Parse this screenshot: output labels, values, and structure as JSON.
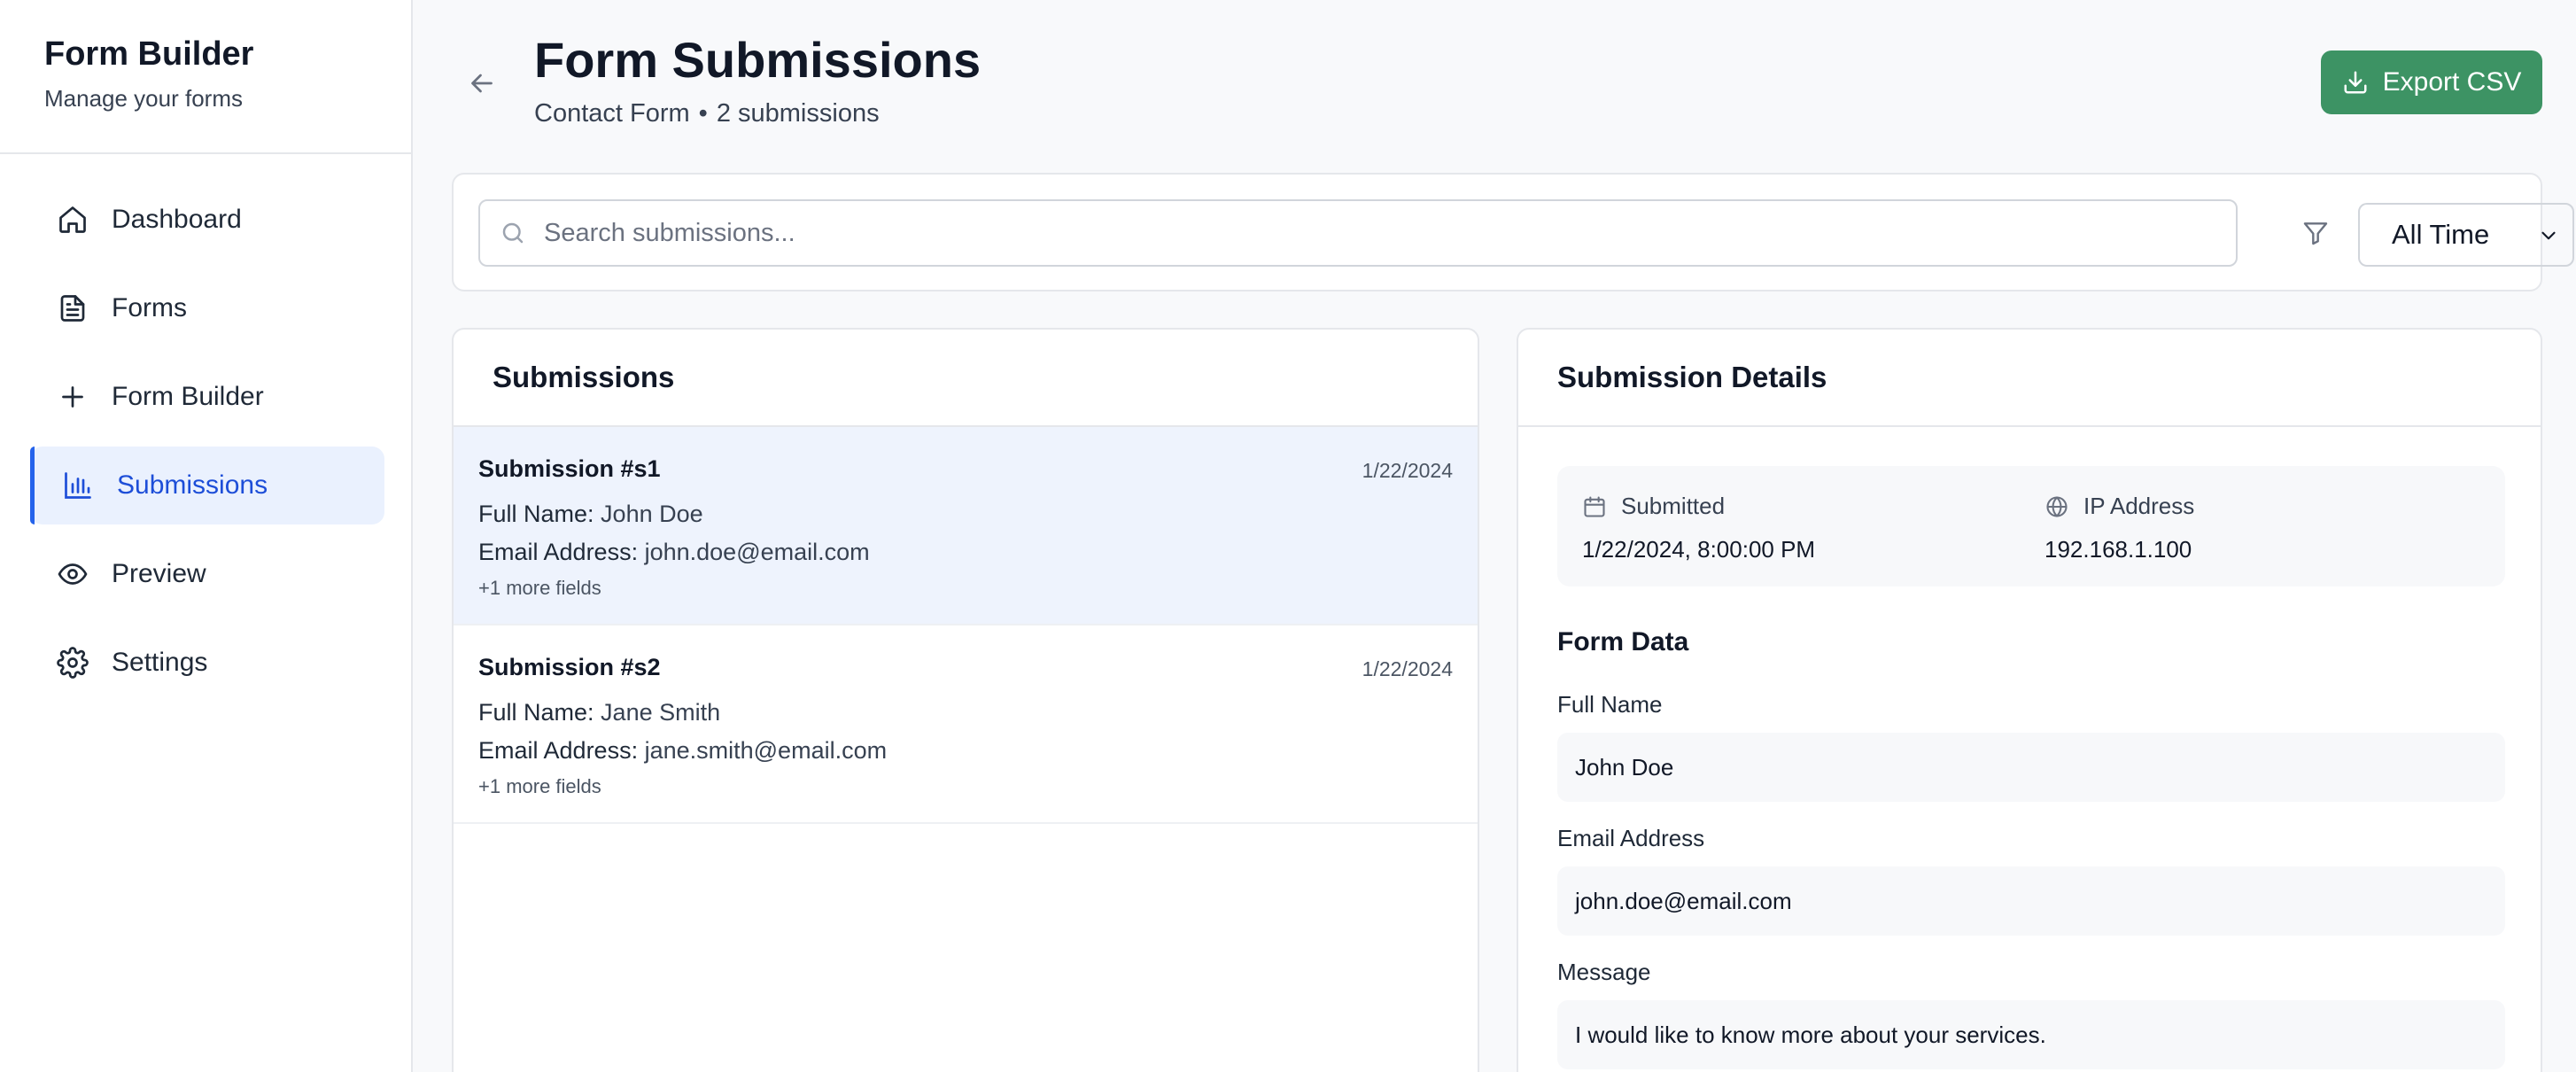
{
  "sidebar": {
    "title": "Form Builder",
    "subtitle": "Manage your forms",
    "items": [
      {
        "label": "Dashboard",
        "icon": "home-icon"
      },
      {
        "label": "Forms",
        "icon": "document-icon"
      },
      {
        "label": "Form Builder",
        "icon": "plus-icon"
      },
      {
        "label": "Submissions",
        "icon": "bar-chart-icon",
        "active": true
      },
      {
        "label": "Preview",
        "icon": "eye-icon"
      },
      {
        "label": "Settings",
        "icon": "gear-icon"
      }
    ]
  },
  "header": {
    "title": "Form Submissions",
    "form_name": "Contact Form",
    "separator": "•",
    "count_text": "2 submissions",
    "export_label": "Export CSV"
  },
  "filters": {
    "search_placeholder": "Search submissions...",
    "time_range": "All Time"
  },
  "list": {
    "title": "Submissions",
    "items": [
      {
        "title": "Submission #s1",
        "date": "1/22/2024",
        "fields": [
          {
            "label": "Full Name:",
            "value": "John Doe"
          },
          {
            "label": "Email Address:",
            "value": "john.doe@email.com"
          }
        ],
        "more": "+1 more fields"
      },
      {
        "title": "Submission #s2",
        "date": "1/22/2024",
        "fields": [
          {
            "label": "Full Name:",
            "value": "Jane Smith"
          },
          {
            "label": "Email Address:",
            "value": "jane.smith@email.com"
          }
        ],
        "more": "+1 more fields"
      }
    ]
  },
  "details": {
    "title": "Submission Details",
    "submitted_label": "Submitted",
    "submitted_value": "1/22/2024, 8:00:00 PM",
    "ip_label": "IP Address",
    "ip_value": "192.168.1.100",
    "form_data_title": "Form Data",
    "fields": [
      {
        "label": "Full Name",
        "value": "John Doe"
      },
      {
        "label": "Email Address",
        "value": "john.doe@email.com"
      },
      {
        "label": "Message",
        "value": "I would like to know more about your services."
      }
    ]
  },
  "colors": {
    "accent": "#2563eb",
    "export_button": "#3d9364",
    "selected_row": "#eef3fd"
  }
}
